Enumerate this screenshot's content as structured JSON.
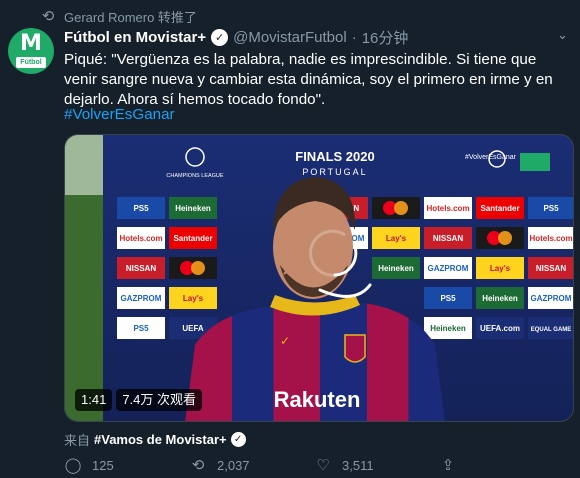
{
  "retweet": {
    "icon": "retweet-icon",
    "text": "Gerard Romero 转推了"
  },
  "author": {
    "avatar_letter": "M",
    "avatar_tag": "Fútbol",
    "display_name": "Fútbol en Movistar+",
    "handle": "@MovistarFutbol",
    "separator": "·",
    "time": "16分钟"
  },
  "tweet": {
    "text": "Piqué: \"Vergüenza es la palabra, nadie es imprescindible. Si tiene que venir sangre nueva y cambiar esta dinámica, soy el primero en irme y en dejarlo. Ahora sí hemos tocado fondo\".",
    "hashtag": "#VolverEsGanar"
  },
  "video": {
    "duration": "1:41",
    "views": "7.4万 次观看",
    "backdrop_title": "FINALS 2020",
    "backdrop_subtitle": "PORTUGAL",
    "backdrop_tag": "#VolverEsGanar",
    "ucl_label": "CHAMPIONS LEAGUE",
    "sponsors": [
      "PS5",
      "Heineken",
      "NISSAN",
      "Mastercard",
      "Hotels.com",
      "Santander",
      "GAZPROM",
      "Lay's",
      "UEFA.com",
      "EQUAL GAME"
    ],
    "shirt_sponsor": "Rakuten"
  },
  "source": {
    "prefix": "来自",
    "name": "#Vamos de Movistar+"
  },
  "actions": {
    "reply": {
      "icon": "reply-icon",
      "count": "125"
    },
    "retweet": {
      "icon": "retweet-icon",
      "count": "2,037"
    },
    "like": {
      "icon": "heart-icon",
      "count": "3,511"
    },
    "share": {
      "icon": "share-icon"
    }
  },
  "colors": {
    "background": "#15202b",
    "secondary_text": "#8899a6",
    "accent": "#1da1f2",
    "avatar": "#1faa68"
  }
}
